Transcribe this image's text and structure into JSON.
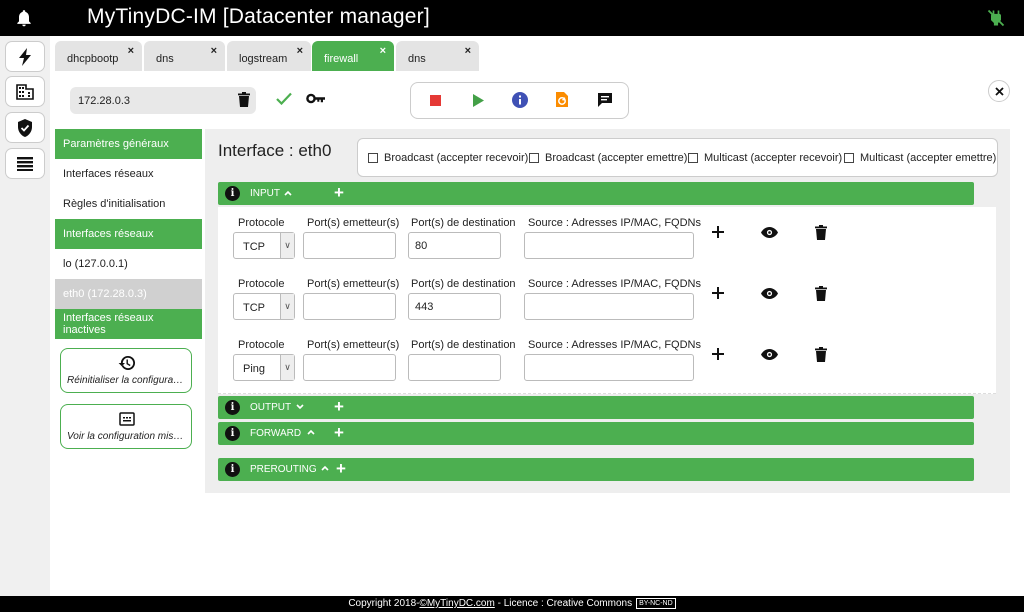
{
  "app": {
    "title": "MyTinyDC-IM [Datacenter manager]"
  },
  "tabs": [
    {
      "label": "dhcpbootp",
      "close": "×"
    },
    {
      "label": "dns",
      "close": "×"
    },
    {
      "label": "logstream",
      "close": "×"
    },
    {
      "label": "firewall",
      "close": "×"
    },
    {
      "label": "dns",
      "close": "×"
    }
  ],
  "toolbar": {
    "ip_value": "172.28.0.3"
  },
  "left_nav": {
    "items": [
      {
        "label": "Paramètres généraux"
      },
      {
        "label": "Interfaces réseaux"
      },
      {
        "label": "Règles d'initialisation"
      },
      {
        "label": "Interfaces réseaux"
      },
      {
        "label": "lo (127.0.0.1)"
      },
      {
        "label": "eth0 (172.28.0.3)"
      },
      {
        "label": "Interfaces réseaux inactives"
      }
    ],
    "reset_button": "Réinitialiser la configuration",
    "view_button": "Voir la configuration mise en place"
  },
  "interface": {
    "title": "Interface : eth0",
    "checkboxes": [
      {
        "label": "Broadcast (accepter recevoir)"
      },
      {
        "label": "Broadcast (accepter emettre)"
      },
      {
        "label": "Multicast (accepter recevoir)"
      },
      {
        "label": "Multicast (accepter emettre)"
      }
    ]
  },
  "sections": {
    "input": "INPUT",
    "output": "OUTPUT",
    "forward": "FORWARD",
    "prerouting": "PREROUTING"
  },
  "rule_headers": {
    "protocol": "Protocole",
    "src_ports": "Port(s) emetteur(s)",
    "dst_ports": "Port(s) de destination",
    "source": "Source : Adresses IP/MAC, FQDNs"
  },
  "rules": [
    {
      "protocol": "TCP",
      "src_ports": "",
      "dst_ports": "80",
      "source": ""
    },
    {
      "protocol": "TCP",
      "src_ports": "",
      "dst_ports": "443",
      "source": ""
    },
    {
      "protocol": "Ping",
      "src_ports": "",
      "dst_ports": "",
      "source": ""
    }
  ],
  "footer": {
    "copyright": "Copyright 2018-",
    "link": "©MyTinyDC.com",
    "licence": " - Licence : Creative Commons",
    "cc_badge": "BY-NC-ND"
  },
  "colors": {
    "accent": "#4caf50",
    "stop": "#e53935",
    "play": "#43a047",
    "info": "#3f51b5",
    "reload": "#fb8c00"
  }
}
